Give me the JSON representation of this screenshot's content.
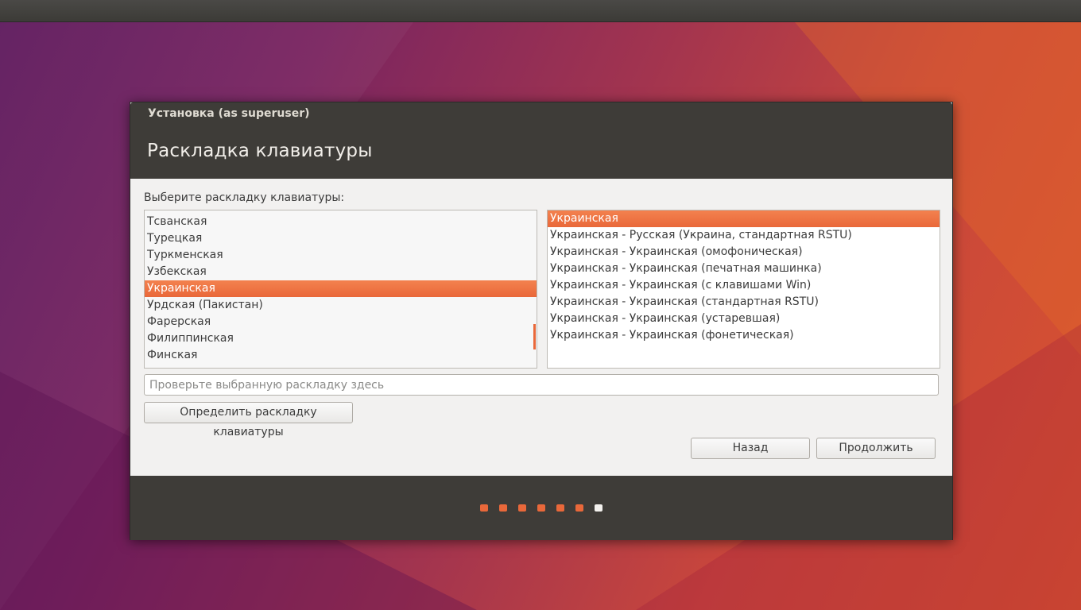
{
  "window": {
    "title": "Установка (as superuser)",
    "page_title": "Раскладка клавиатуры"
  },
  "prompt": "Выберите раскладку клавиатуры:",
  "layouts": {
    "items": [
      "Тсванская",
      "Турецкая",
      "Туркменская",
      "Узбекская",
      "Украинская",
      "Урдская (Пакистан)",
      "Фарерская",
      "Филиппинская",
      "Финская"
    ],
    "selected": "Украинская"
  },
  "variants": {
    "items": [
      "Украинская",
      "Украинская - Русская (Украина, стандартная RSTU)",
      "Украинская - Украинская (омофоническая)",
      "Украинская - Украинская (печатная машинка)",
      "Украинская - Украинская (с клавишами Win)",
      "Украинская - Украинская (стандартная RSTU)",
      "Украинская - Украинская (устаревшая)",
      "Украинская - Украинская (фонетическая)"
    ],
    "selected": "Украинская"
  },
  "test_input": {
    "value": "",
    "placeholder": "Проверьте выбранную раскладку здесь"
  },
  "buttons": {
    "detect": "Определить раскладку клавиатуры",
    "back": "Назад",
    "continue": "Продолжить"
  },
  "progress": {
    "total_steps": 7,
    "current_step": 7
  },
  "colors": {
    "accent": "#e9683a",
    "header": "#3e3c38",
    "window_bg": "#f2f1f0"
  }
}
